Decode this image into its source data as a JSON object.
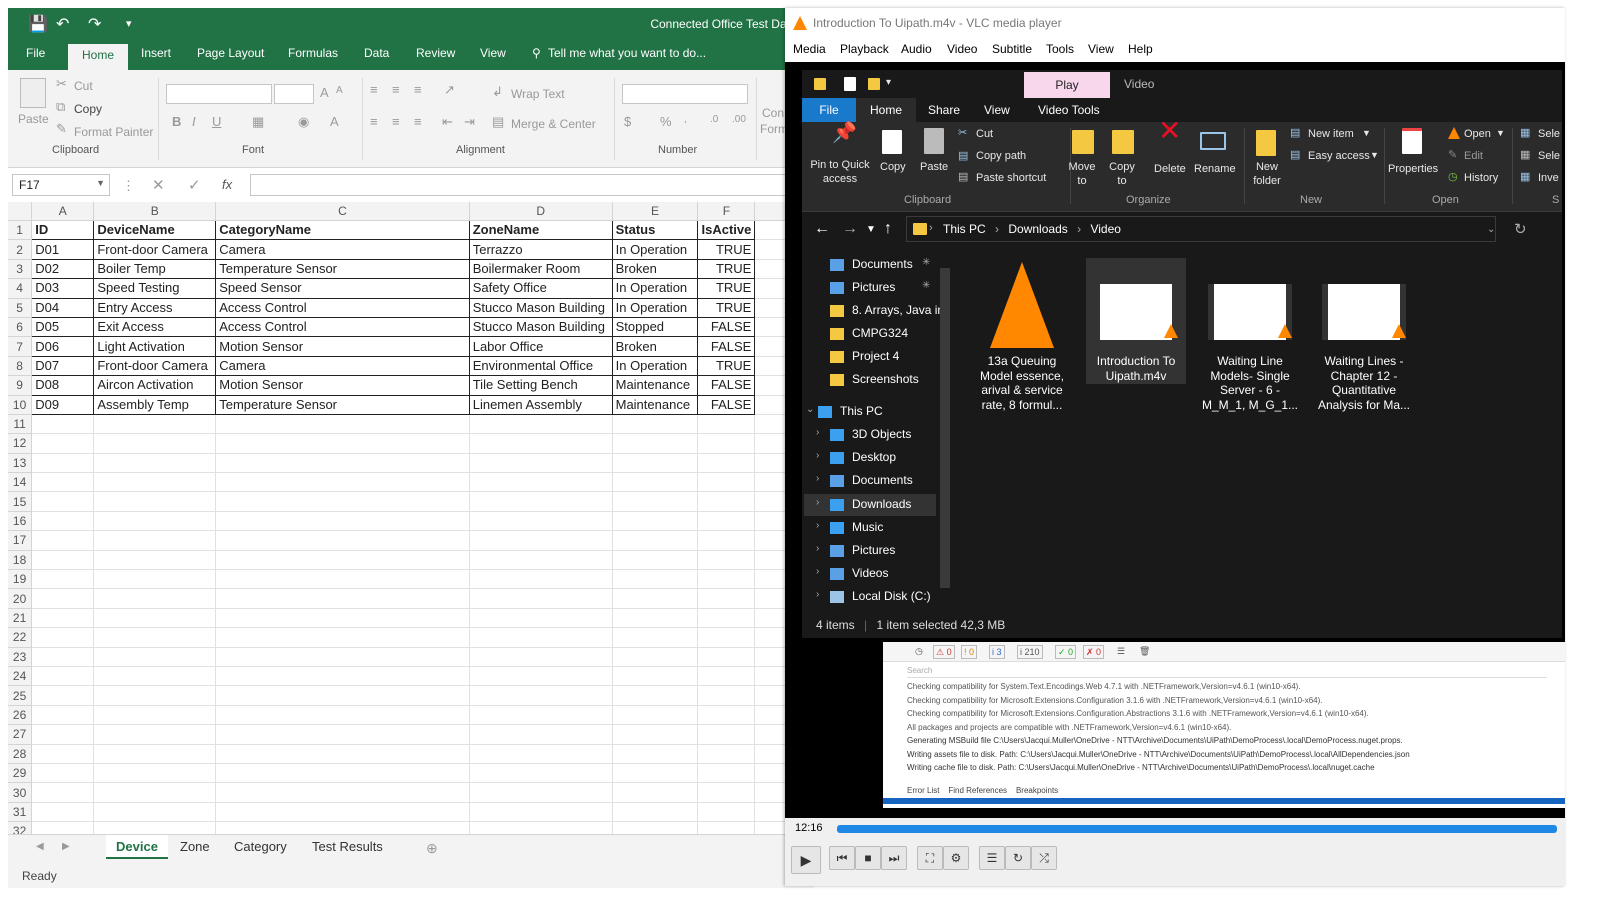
{
  "excel": {
    "doc_title": "Connected Office Test Data.x",
    "tabs": [
      "File",
      "Home",
      "Insert",
      "Page Layout",
      "Formulas",
      "Data",
      "Review",
      "View"
    ],
    "tell_me": "Tell me what you want to do...",
    "ribbon": {
      "cut": "Cut",
      "copy": "Copy",
      "format_painter": "Format Painter",
      "paste": "Paste",
      "wrap_text": "Wrap Text",
      "merge_center": "Merge & Center",
      "con": "Con",
      "form": "Form",
      "groups": {
        "clipboard": "Clipboard",
        "font": "Font",
        "alignment": "Alignment",
        "number": "Number"
      }
    },
    "name_box": "F17",
    "fx": "fx",
    "columns": [
      "A",
      "B",
      "C",
      "D",
      "E",
      "F"
    ],
    "headers": [
      "ID",
      "DeviceName",
      "CategoryName",
      "ZoneName",
      "Status",
      "IsActive"
    ],
    "rows": [
      [
        "D01",
        "Front-door Camera",
        "Camera",
        "Terrazzo",
        "In Operation",
        "TRUE"
      ],
      [
        "D02",
        "Boiler Temp",
        "Temperature Sensor",
        "Boilermaker Room",
        "Broken",
        "TRUE"
      ],
      [
        "D03",
        "Speed Testing",
        "Speed Sensor",
        "Safety Office",
        "In Operation",
        "TRUE"
      ],
      [
        "D04",
        "Entry Access",
        "Access Control",
        "Stucco Mason Building",
        "In Operation",
        "TRUE"
      ],
      [
        "D05",
        "Exit Access",
        "Access Control",
        "Stucco Mason Building",
        "Stopped",
        "FALSE"
      ],
      [
        "D06",
        "Light Activation",
        "Motion Sensor",
        "Labor Office",
        "Broken",
        "FALSE"
      ],
      [
        "D07",
        "Front-door Camera",
        "Camera",
        "Environmental Office",
        "In Operation",
        "TRUE"
      ],
      [
        "D08",
        "Aircon Activation",
        "Motion Sensor",
        "Tile Setting Bench",
        "Maintenance",
        "FALSE"
      ],
      [
        "D09",
        "Assembly Temp",
        "Temperature Sensor",
        "Linemen Assembly",
        "Maintenance",
        "FALSE"
      ]
    ],
    "row_numbers": [
      "1",
      "2",
      "3",
      "4",
      "5",
      "6",
      "7",
      "8",
      "9",
      "10",
      "11",
      "12",
      "13",
      "14",
      "15",
      "16",
      "17",
      "18",
      "19",
      "20",
      "21",
      "22",
      "23",
      "24",
      "25",
      "26",
      "27",
      "28",
      "29",
      "30",
      "31",
      "32"
    ],
    "sheets": [
      "Device",
      "Zone",
      "Category",
      "Test Results"
    ],
    "status": "Ready"
  },
  "vlc": {
    "title": "Introduction To Uipath.m4v - VLC media player",
    "menu": [
      "Media",
      "Playback",
      "Audio",
      "Video",
      "Subtitle",
      "Tools",
      "View",
      "Help"
    ],
    "time": "12:16",
    "output": {
      "badges": [
        "0",
        "0",
        "3",
        "210",
        "0",
        "0"
      ],
      "search": "Search",
      "lines": [
        "Checking compatibility for System.Text.Encodings.Web 4.7.1 with .NETFramework,Version=v4.6.1 (win10-x64).",
        "Checking compatibility for Microsoft.Extensions.Configuration 3.1.6 with .NETFramework,Version=v4.6.1 (win10-x64).",
        "Checking compatibility for Microsoft.Extensions.Configuration.Abstractions 3.1.6 with .NETFramework,Version=v4.6.1 (win10-x64).",
        "All packages and projects are compatible with .NETFramework,Version=v4.6.1 (win10-x64).",
        "Generating MSBuild file C:\\Users\\Jacqui.Muller\\OneDrive - NTT\\Archive\\Documents\\UiPath\\DemoProcess\\.local\\DemoProcess.nuget.props.",
        "Writing assets file to disk. Path: C:\\Users\\Jacqui.Muller\\OneDrive - NTT\\Archive\\Documents\\UiPath\\DemoProcess\\.local\\AllDependencies.json",
        "Writing cache file to disk. Path: C:\\Users\\Jacqui.Muller\\OneDrive - NTT\\Archive\\Documents\\UiPath\\DemoProcess\\.local\\nuget.cache"
      ],
      "tabs": [
        "Error List",
        "Find References",
        "Breakpoints"
      ]
    }
  },
  "explorer": {
    "context_tab": "Play",
    "context_title": "Video",
    "tabs": [
      "File",
      "Home",
      "Share",
      "View",
      "Video Tools"
    ],
    "ribbon": {
      "pin": "Pin to Quick access",
      "copy": "Copy",
      "paste": "Paste",
      "cut": "Cut",
      "copy_path": "Copy path",
      "paste_shortcut": "Paste shortcut",
      "move_to": "Move to",
      "copy_to": "Copy to",
      "delete": "Delete",
      "rename": "Rename",
      "new_folder": "New folder",
      "new_item": "New item",
      "easy_access": "Easy access",
      "properties": "Properties",
      "open": "Open",
      "edit": "Edit",
      "history": "History",
      "select_all": "Sele",
      "select_none": "Sele",
      "invert": "Inve",
      "groups": {
        "clipboard": "Clipboard",
        "organize": "Organize",
        "new": "New",
        "open": "Open",
        "select": "S"
      }
    },
    "breadcrumb": [
      "This PC",
      "Downloads",
      "Video"
    ],
    "sidebar": [
      {
        "label": "Documents",
        "color": "#5aa0e6"
      },
      {
        "label": "Pictures",
        "color": "#5aa0e6"
      },
      {
        "label": "8. Arrays, Java in",
        "color": "#f5c842"
      },
      {
        "label": "CMPG324",
        "color": "#f5c842"
      },
      {
        "label": "Project 4",
        "color": "#f5c842"
      },
      {
        "label": "Screenshots",
        "color": "#f5c842"
      },
      {
        "label": "This PC",
        "color": "#3ca0f0"
      },
      {
        "label": "3D Objects",
        "color": "#3ca0f0"
      },
      {
        "label": "Desktop",
        "color": "#3ca0f0"
      },
      {
        "label": "Documents",
        "color": "#5aa0e6"
      },
      {
        "label": "Downloads",
        "color": "#3ca0f0"
      },
      {
        "label": "Music",
        "color": "#3ca0f0"
      },
      {
        "label": "Pictures",
        "color": "#5aa0e6"
      },
      {
        "label": "Videos",
        "color": "#5aa0e6"
      },
      {
        "label": "Local Disk (C:)",
        "color": "#9bc4e6"
      }
    ],
    "files": [
      {
        "name": "13a Queuing Model essence, arival & service rate, 8 formul..."
      },
      {
        "name": "Introduction To Uipath.m4v"
      },
      {
        "name": "Waiting Line Models- Single Server - 6 - M_M_1, M_G_1..."
      },
      {
        "name": "Waiting Lines - Chapter 12 - Quantitative Analysis for Ma..."
      }
    ],
    "status_items": "4 items",
    "status_selected": "1 item selected  42,3 MB"
  }
}
